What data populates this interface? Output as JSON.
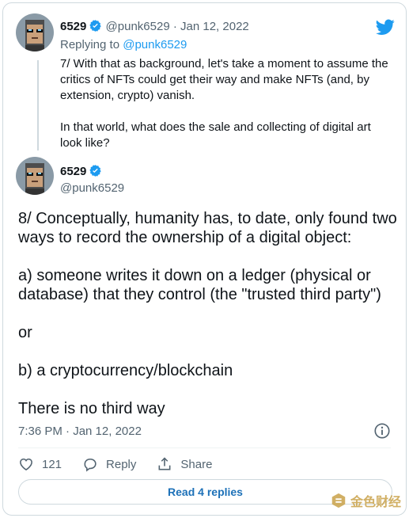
{
  "parent_tweet": {
    "author_name": "6529",
    "handle": "@punk6529",
    "separator": " · ",
    "date": "Jan 12, 2022",
    "replying_label": "Replying to ",
    "replying_handle": "@punk6529",
    "paragraphs": [
      "7/ With that as background, let's take a moment to assume the critics of NFTs could get their way and make NFTs (and, by extension, crypto) vanish.",
      "In that world, what does the sale and collecting of digital art look like?"
    ]
  },
  "main_tweet": {
    "author_name": "6529",
    "handle": "@punk6529",
    "paragraphs": [
      "8/ Conceptually, humanity has, to date, only found two ways to record the ownership of a digital object:",
      "a) someone writes it down on a ledger (physical or database) that they control (the \"trusted third party\")",
      "or",
      "b) a cryptocurrency/blockchain",
      "There is no third way"
    ],
    "timestamp": "7:36 PM · Jan 12, 2022"
  },
  "actions": {
    "like_count": "121",
    "reply_label": "Reply",
    "share_label": "Share"
  },
  "read_replies_label": "Read 4 replies",
  "watermark_text": "金色财经",
  "colors": {
    "twitter_blue": "#1d9bf0",
    "muted_text": "#536471",
    "border": "#cfd9de",
    "link_text": "#1d71b8"
  },
  "icons": [
    "twitter-bird-icon",
    "verified-badge-icon",
    "info-icon",
    "heart-icon",
    "reply-bubble-icon",
    "share-icon"
  ]
}
